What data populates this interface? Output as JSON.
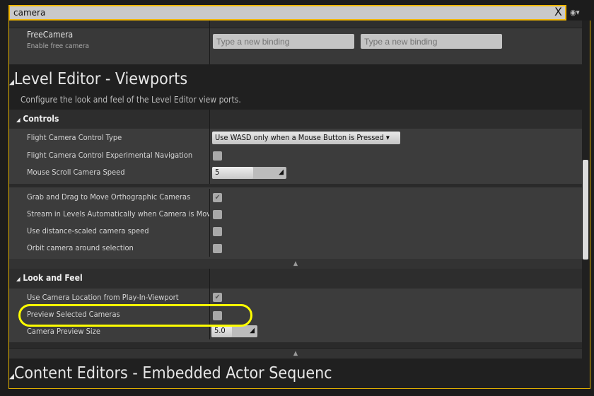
{
  "search": {
    "value": "camera",
    "clear_icon": "X"
  },
  "options_icon": "eye-icon",
  "free_camera": {
    "label": "FreeCamera",
    "description": "Enable free camera",
    "binding_placeholder": "Type a new binding"
  },
  "section": {
    "title": "Level Editor - Viewports",
    "description": "Configure the look and feel of the Level Editor view ports."
  },
  "controls": {
    "title": "Controls",
    "flight_type": {
      "label": "Flight Camera Control Type",
      "value": "Use WASD only when a Mouse Button is Pressed"
    },
    "flight_nav": {
      "label": "Flight Camera Control Experimental Navigation",
      "checked": false
    },
    "scroll_speed": {
      "label": "Mouse Scroll Camera Speed",
      "value": "5"
    },
    "grab_drag": {
      "label": "Grab and Drag to Move Orthographic Cameras",
      "checked": true
    },
    "stream": {
      "label": "Stream in Levels Automatically when Camera is Moving",
      "checked": false
    },
    "distance": {
      "label": "Use distance-scaled camera speed",
      "checked": false
    },
    "orbit": {
      "label": "Orbit camera around selection",
      "checked": false
    }
  },
  "look": {
    "title": "Look and Feel",
    "use_loc": {
      "label": "Use Camera Location from Play-In-Viewport",
      "checked": true
    },
    "preview": {
      "label": "Preview Selected Cameras",
      "checked": false
    },
    "preview_size": {
      "label": "Camera Preview Size",
      "value": "5.0"
    }
  },
  "next_section": {
    "title": "Content Editors - Embedded Actor Sequenc"
  },
  "highlight_color": "#ffff00"
}
